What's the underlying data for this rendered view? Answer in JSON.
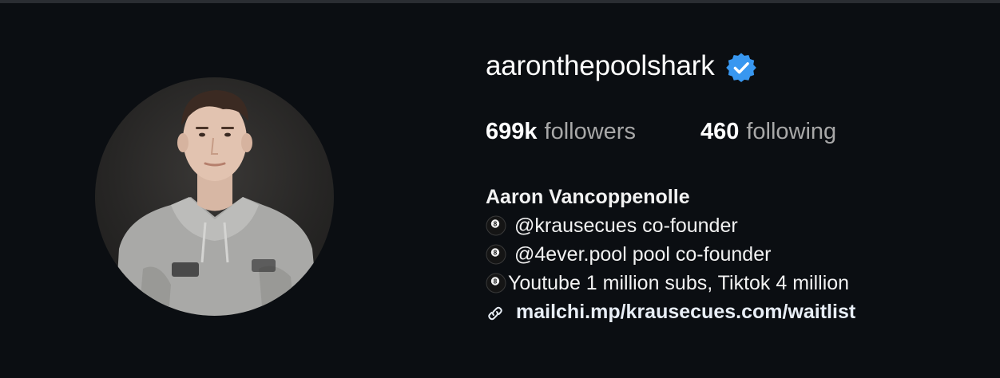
{
  "profile": {
    "username": "aaronthepoolshark",
    "verified": true,
    "verified_icon": "verified-badge-icon",
    "avatar_icon": "profile-photo",
    "colors": {
      "background": "#0b0e12",
      "verified": "#3897f0",
      "muted": "#a8a8a8"
    }
  },
  "stats": {
    "followers_count": "699k",
    "followers_label": "followers",
    "following_count": "460",
    "following_label": "following"
  },
  "bio": {
    "full_name": "Aaron Vancoppenolle",
    "lines": [
      {
        "icon": "8-ball-icon",
        "text": "@krausecues co-founder"
      },
      {
        "icon": "8-ball-icon",
        "text": "@4ever.pool pool co-founder"
      },
      {
        "icon": "8-ball-icon",
        "text": "Youtube 1 million subs, Tiktok 4 million"
      }
    ],
    "link": {
      "icon": "link-icon",
      "text": "mailchi.mp/krausecues.com/waitlist"
    }
  }
}
